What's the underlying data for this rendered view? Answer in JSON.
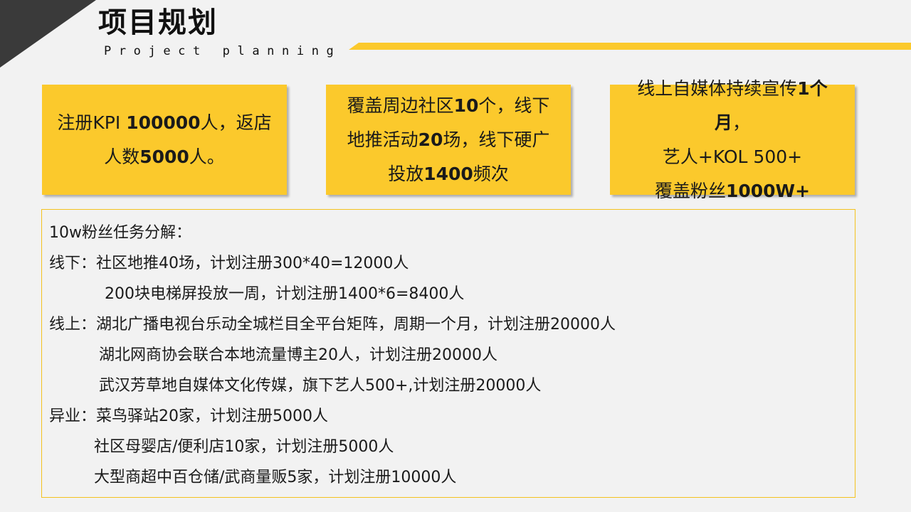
{
  "header": {
    "title": "项目规划",
    "subtitle": "Project planning"
  },
  "colors": {
    "accent": "#fbc92c",
    "corner": "#3a3a3a",
    "border": "#f4c21f"
  },
  "cards": [
    {
      "lines": [
        [
          {
            "t": "注册KPI "
          },
          {
            "t": "100000",
            "b": true
          },
          {
            "t": "人，返店"
          }
        ],
        [
          {
            "t": "人数"
          },
          {
            "t": "5000",
            "b": true
          },
          {
            "t": "人。"
          }
        ]
      ]
    },
    {
      "lines": [
        [
          {
            "t": "覆盖周边社区"
          },
          {
            "t": "10",
            "b": true
          },
          {
            "t": "个，线下"
          }
        ],
        [
          {
            "t": "地推活动"
          },
          {
            "t": "20",
            "b": true
          },
          {
            "t": "场，线下硬广"
          }
        ],
        [
          {
            "t": "投放"
          },
          {
            "t": "1400",
            "b": true
          },
          {
            "t": "频次"
          }
        ]
      ]
    },
    {
      "lines": [
        [
          {
            "t": "线上自媒体持续宣传"
          },
          {
            "t": "1个月",
            "b": true
          },
          {
            "t": "，"
          }
        ],
        [
          {
            "t": "艺人+KOL 500+"
          }
        ],
        [
          {
            "t": "覆盖粉丝"
          },
          {
            "t": "1000W+",
            "b": true
          }
        ]
      ]
    }
  ],
  "breakdown": {
    "heading": "10w粉丝任务分解：",
    "offline_1": "线下：社区地推40场，计划注册300*40=12000人",
    "offline_2": "200块电梯屏投放一周，计划注册1400*6=8400人",
    "online_1": "线上：湖北广播电视台乐动全城栏目全平台矩阵，周期一个月，计划注册20000人",
    "online_2": "湖北网商协会联合本地流量博主20人，计划注册20000人",
    "online_3": "武汉芳草地自媒体文化传媒，旗下艺人500+,计划注册20000人",
    "crossover_1": "异业：菜鸟驿站20家，计划注册5000人",
    "crossover_2": "社区母婴店/便利店10家，计划注册5000人",
    "crossover_3": "大型商超中百仓储/武商量贩5家，计划注册10000人"
  }
}
